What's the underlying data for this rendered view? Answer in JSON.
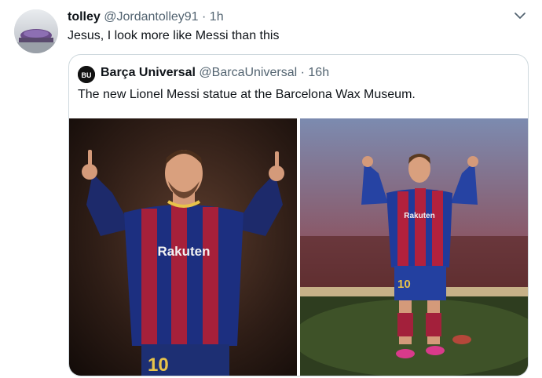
{
  "tweet": {
    "display_name": "tolley",
    "handle": "@Jordantolley91",
    "separator": "·",
    "time": "1h",
    "text": "Jesus, I look more like Messi than this",
    "menu_icon": "chevron-down-icon",
    "avatar_icon": "profile-avatar"
  },
  "quoted": {
    "display_name": "Barça Universal",
    "handle": "@BarcaUniversal",
    "separator": "·",
    "time": "16h",
    "text": "The new Lionel Messi statue at the Barcelona Wax Museum.",
    "avatar_label": "BU",
    "photos": {
      "left": {
        "shirt_text": "Rakuten",
        "number": "10"
      },
      "right": {
        "shirt_text": "Rakuten",
        "number": "10"
      }
    }
  }
}
